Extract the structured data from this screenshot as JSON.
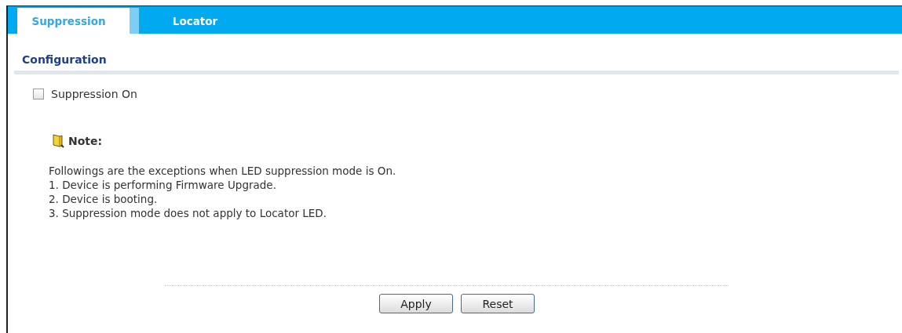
{
  "tabs": [
    {
      "label": "Suppression",
      "selected": true
    },
    {
      "label": "Locator",
      "selected": false
    }
  ],
  "section": {
    "title": "Configuration"
  },
  "checkbox": {
    "label": "Suppression On",
    "checked": false
  },
  "note": {
    "title": "Note:",
    "lines": [
      "Followings are the exceptions when LED suppression mode is On.",
      "1. Device is performing Firmware Upgrade.",
      "2. Device is booting.",
      "3. Suppression mode does not apply to Locator LED."
    ]
  },
  "buttons": [
    "Apply",
    "Reset"
  ]
}
